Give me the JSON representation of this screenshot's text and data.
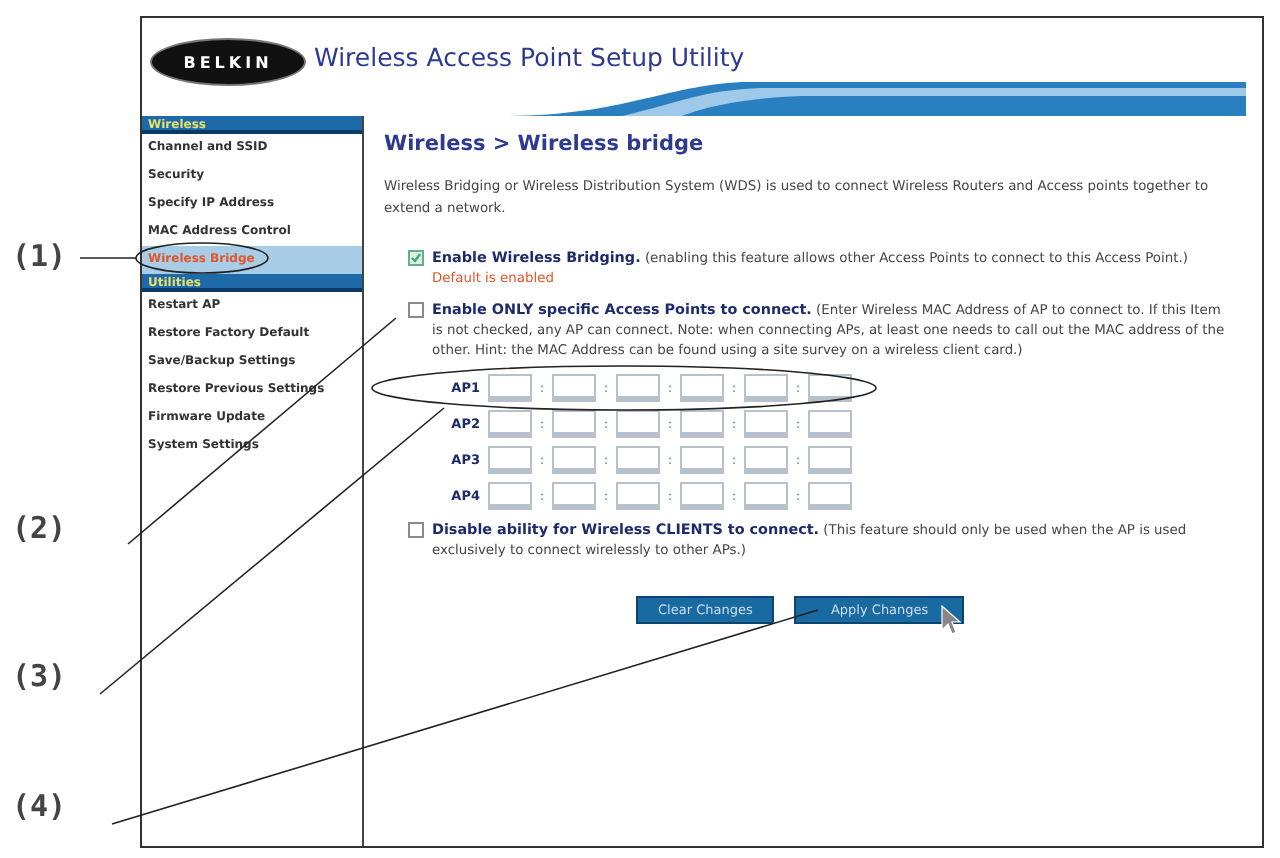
{
  "header": {
    "logo": "BELKIN",
    "title": "Wireless Access Point Setup Utility"
  },
  "sidebar": {
    "sections": [
      {
        "heading": "Wireless",
        "items": [
          {
            "label": "Channel and SSID",
            "selected": false
          },
          {
            "label": "Security",
            "selected": false
          },
          {
            "label": "Specify IP Address",
            "selected": false
          },
          {
            "label": "MAC Address Control",
            "selected": false
          },
          {
            "label": "Wireless Bridge",
            "selected": true
          }
        ]
      },
      {
        "heading": "Utilities",
        "items": [
          {
            "label": "Restart AP",
            "selected": false
          },
          {
            "label": "Restore Factory Default",
            "selected": false
          },
          {
            "label": "Save/Backup Settings",
            "selected": false
          },
          {
            "label": "Restore Previous Settings",
            "selected": false
          },
          {
            "label": "Firmware Update",
            "selected": false
          },
          {
            "label": "System Settings",
            "selected": false
          }
        ]
      }
    ]
  },
  "content": {
    "title": "Wireless > Wireless bridge",
    "intro": "Wireless Bridging or Wireless Distribution System (WDS) is used to connect Wireless Routers and Access points together to extend a network.",
    "options": [
      {
        "checked": true,
        "text": "**Enable Wireless Bridging.** (enabling this feature allows other Access Points to connect to this Access Point.)",
        "note": "Default is enabled"
      },
      {
        "checked": false,
        "text": "**Enable ONLY specific Access Points to connect.** (Enter Wireless MAC Address of AP to connect to. If this Item is not checked, any AP can connect. Note: when connecting APs, at least one needs to call out the MAC address of the other. Hint: the MAC Address can be found using a site survey on a wireless client card.)"
      }
    ],
    "ap_rows": [
      {
        "label": "AP1",
        "separators": [
          ":",
          ":",
          ":",
          ":",
          ":"
        ]
      },
      {
        "label": "AP2",
        "separators": [
          ":",
          ":",
          ":",
          ":",
          ":"
        ]
      },
      {
        "label": "AP3",
        "separators": [
          ":",
          ":",
          ":",
          ":",
          ":"
        ]
      },
      {
        "label": "AP4",
        "separators": [
          ":",
          ":",
          ":",
          ":",
          ":"
        ]
      }
    ],
    "client_option": {
      "checked": false,
      "text": "**Disable ability for Wireless CLIENTS to connect.** (This feature should only be used when the AP is used exclusively to connect wirelessly to other APs.)"
    },
    "buttons": [
      "Clear Changes",
      "Apply Changes"
    ]
  },
  "callouts": [
    {
      "label": "(1)"
    },
    {
      "label": "(2)"
    },
    {
      "label": "(3)"
    },
    {
      "label": "(4)"
    }
  ]
}
